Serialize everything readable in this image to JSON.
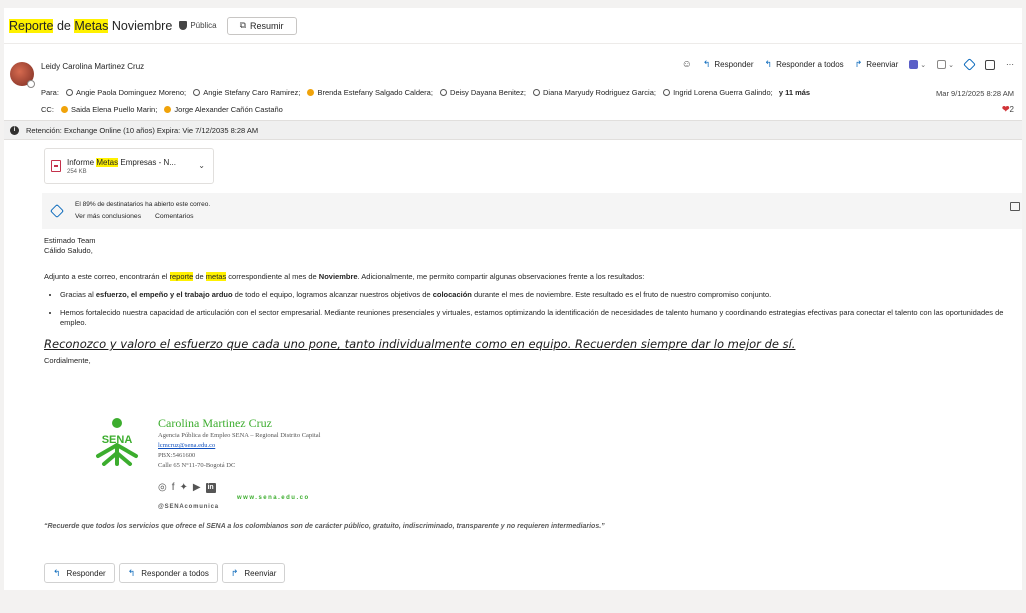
{
  "subject": {
    "word1": "Reporte",
    "word2": " de ",
    "word3": "Metas",
    "word4": " Noviembre",
    "visibility": "Pública",
    "summarize_label": "Resumir"
  },
  "message": {
    "sender": "Leidy Carolina Martinez Cruz",
    "to_label": "Para:",
    "to": [
      "Angie Paola Dominguez Moreno;",
      "Angie Stefany Caro Ramirez;",
      "Brenda Estefany Salgado Caldera;",
      "Deisy Dayana Benitez;",
      "Diana Maryudy Rodriguez Garcia;",
      "Ingrid Lorena Guerra Galindo;"
    ],
    "more": "y 11 más",
    "cc_label": "CC:",
    "cc": [
      "Saida Elena Puello Marin;",
      "Jorge Alexander Cañón Castaño"
    ],
    "date": "Mar 9/12/2025 8:28 AM",
    "reaction_count": "2"
  },
  "actions": {
    "reply": "Responder",
    "reply_all": "Responder a todos",
    "forward": "Reenviar",
    "more": "···"
  },
  "retention": "Retención: Exchange Online (10 años) Expira: Vie 7/12/2035 8:28 AM",
  "attachment": {
    "name_pre": "Informe ",
    "name_hl": "Metas",
    "name_post": " Empresas - N...",
    "size": "254 KB"
  },
  "insights": {
    "text": "El 89% de destinatarios ha abierto este correo.",
    "link1": "Ver más conclusiones",
    "link2": "Comentarios"
  },
  "body": {
    "greet1": "Estimado Team",
    "greet2": "Cálido Saludo,",
    "intro_a": "Adjunto a este correo, encontrarán el ",
    "intro_hl1": "reporte",
    "intro_b": " de ",
    "intro_hl2": "metas",
    "intro_c": " correspondiente al mes de ",
    "intro_bold": "Noviembre",
    "intro_d": ". Adicionalmente, me permito compartir algunas observaciones frente a los resultados:",
    "b1_a": "Gracias al ",
    "b1_bold1": "esfuerzo, el empeño y el trabajo arduo",
    "b1_b": " de todo el equipo, logramos alcanzar nuestros objetivos de ",
    "b1_bold2": "colocación",
    "b1_c": " durante el mes de noviembre. Este resultado es el fruto de nuestro compromiso conjunto.",
    "b2": "Hemos fortalecido nuestra capacidad de articulación con el sector empresarial. Mediante reuniones presenciales y virtuales, estamos optimizando la identificación de necesidades de talento humano y coordinando estrategias efectivas para conectar el talento con las oportunidades de empleo.",
    "quote": "Reconozco y valoro el esfuerzo que cada uno pone, tanto individualmente como en equipo. Recuerden siempre dar lo mejor de sí.",
    "closing": "Cordialmente,"
  },
  "signature": {
    "logo_text": "SENA",
    "name": "Carolina Martinez Cruz",
    "org": "Agencia Pública de Empleo SENA – Regional Distrito Capital",
    "email": "lcmcruz@sena.edu.co",
    "phone": "PBX:5461600",
    "address": "Calle 65 N°11-70-Bogotá DC",
    "web": "www.sena.edu.co",
    "handle": "@SENAcomunica"
  },
  "disclaimer": "“Recuerde que todos los servicios que ofrece el SENA a los colombianos son de carácter público, gratuito, indiscriminado, transparente y no requieren intermediarios.”",
  "colors": {
    "accent": "#0f6cbd",
    "highlight": "#fff100",
    "sena_green": "#3cad2e",
    "heart": "#d13438"
  }
}
